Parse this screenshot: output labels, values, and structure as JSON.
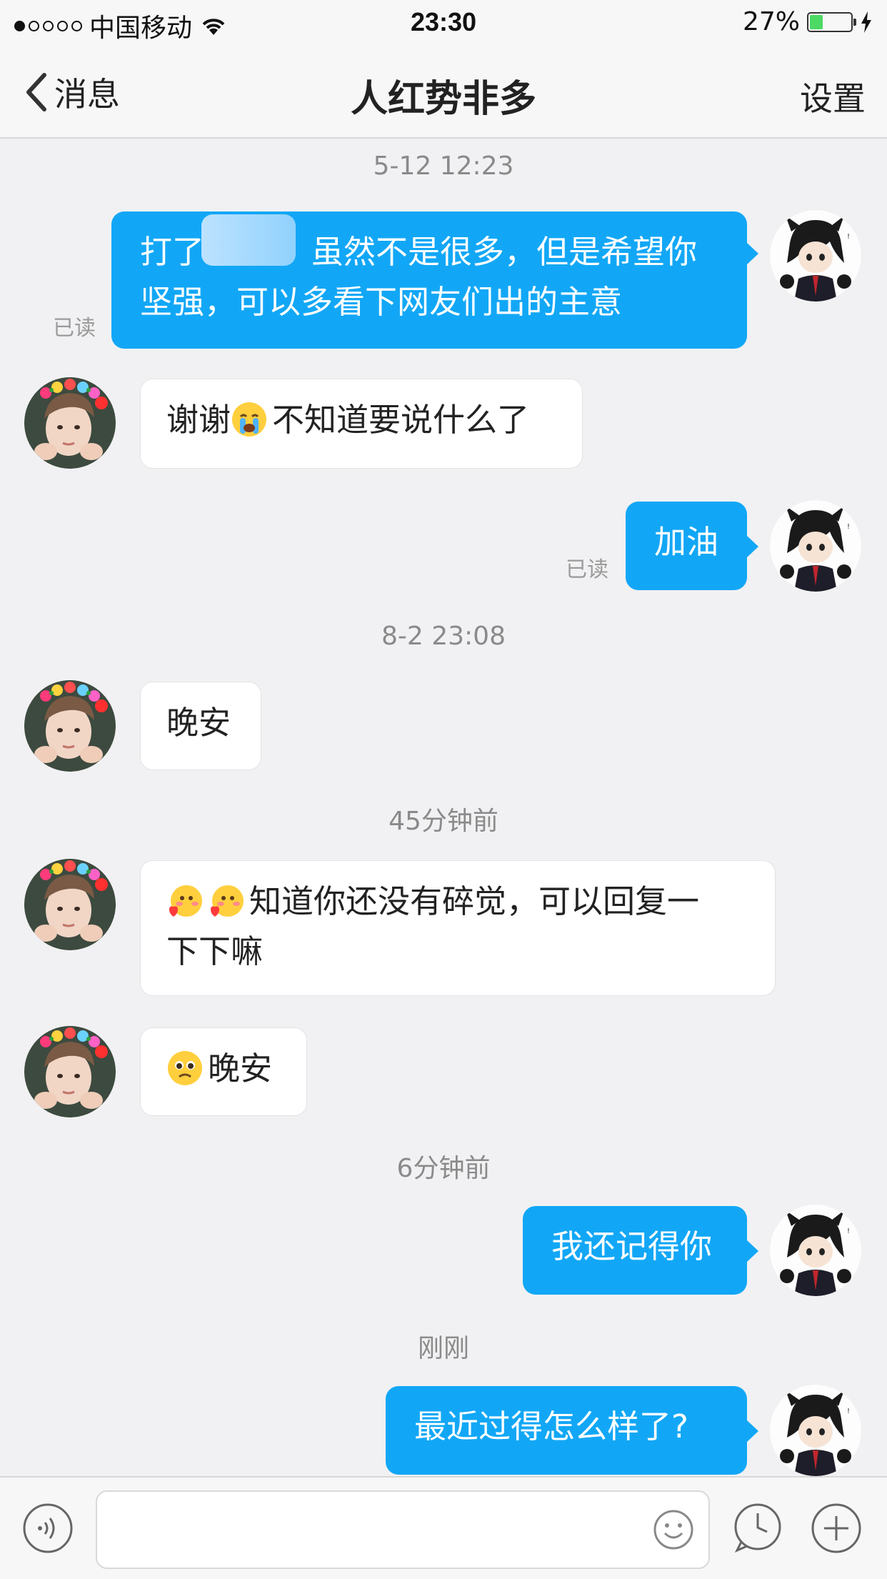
{
  "status_bar": {
    "carrier": "中国移动",
    "time": "23:30",
    "battery_percent": "27%",
    "battery_level": 0.27
  },
  "nav": {
    "back_label": "消息",
    "title": "人红势非多",
    "settings_label": "设置"
  },
  "messages": {
    "ts1": "5-12 12:23",
    "m1": {
      "line1_prefix": "打了",
      "line1_suffix": "虽然不是很多，但是希望你",
      "line2": "坚强，可以多看下网友们出的主意",
      "read": "已读"
    },
    "m2": {
      "text": "谢谢",
      "text_after_emoji": "不知道要说什么了",
      "emoji": "crying-face-emoji"
    },
    "m3": {
      "text": "加油",
      "read": "已读"
    },
    "ts2": "8-2 23:08",
    "m4": {
      "text": "晚安"
    },
    "ts3": "45分钟前",
    "m5": {
      "line1": "知道你还没有碎觉，可以回复一",
      "line2": "下下嘛",
      "emoji": "blushing-heart-emoji"
    },
    "m6": {
      "text": "晚安",
      "emoji": "pleading-face-emoji"
    },
    "ts4": "6分钟前",
    "m7": {
      "text": "我还记得你"
    },
    "ts5": "刚刚",
    "m8": {
      "text": "最近过得怎么样了?"
    }
  },
  "input_bar": {
    "placeholder": "",
    "icons": [
      "voice-icon",
      "emoji-icon",
      "clock-icon",
      "plus-icon"
    ]
  },
  "colors": {
    "outgoing_bubble": "#12a7f6",
    "incoming_bubble": "#ffffff",
    "background": "#f1f1f3"
  }
}
